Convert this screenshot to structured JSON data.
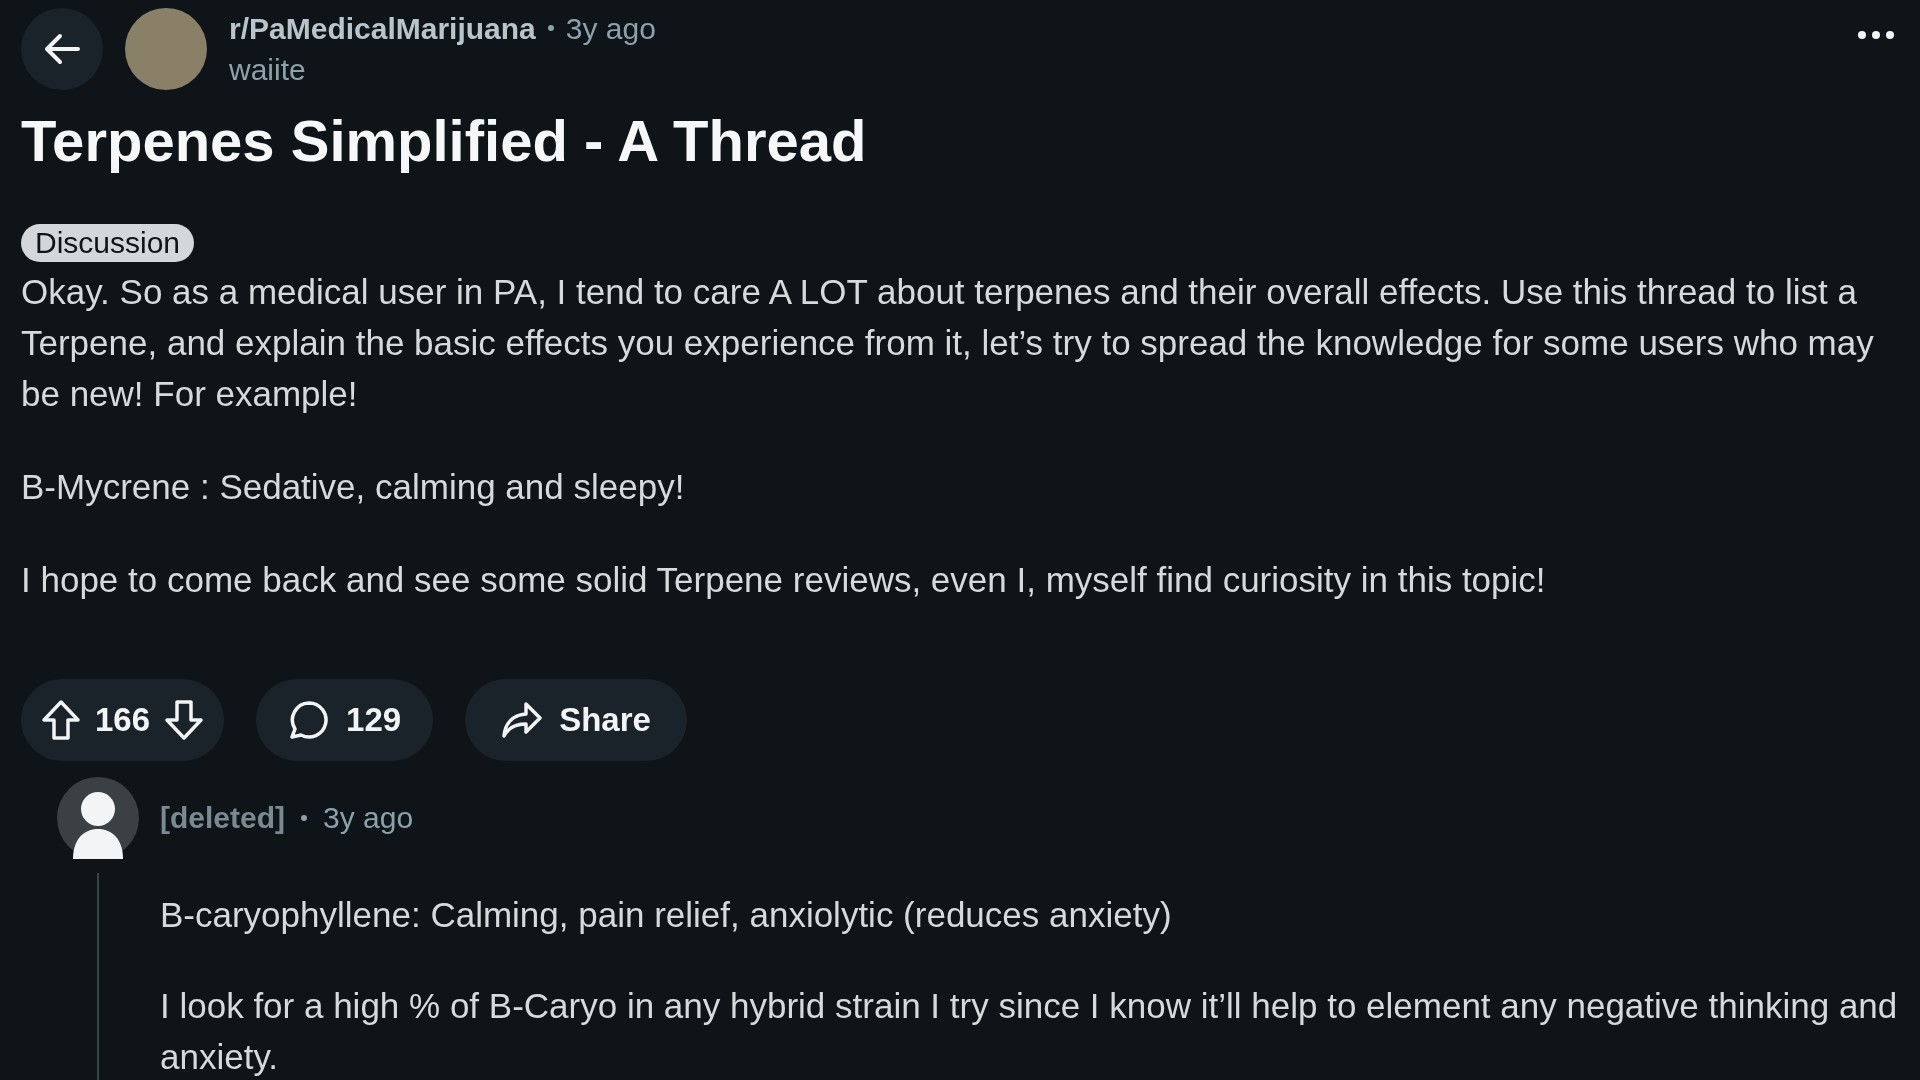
{
  "header": {
    "subreddit": "r/PaMedicalMarijuana",
    "time": "3y ago",
    "author": "waiite"
  },
  "post": {
    "title": "Terpenes Simplified - A Thread",
    "flair": "Discussion",
    "paragraphs": [
      "Okay. So as a medical user in PA, I tend to care A LOT about terpenes and their overall effects. Use this thread to list a Terpene, and explain the basic effects you experience from it, let’s try to spread the knowledge for some users who may be new! For example!",
      "B-Mycrene : Sedative, calming and sleepy!",
      "I hope to come back and see some solid Terpene reviews, even I, myself find curiosity in this topic!"
    ]
  },
  "actions": {
    "score": "166",
    "comments": "129",
    "share": "Share"
  },
  "comments": [
    {
      "author": "[deleted]",
      "time": "3y ago",
      "paragraphs": [
        "B-caryophyllene: Calming, pain relief, anxiolytic (reduces anxiety)",
        "I look for a high % of B-Caryo in any hybrid strain I try since I know it’ll help to element any negative thinking and anxiety."
      ]
    }
  ]
}
